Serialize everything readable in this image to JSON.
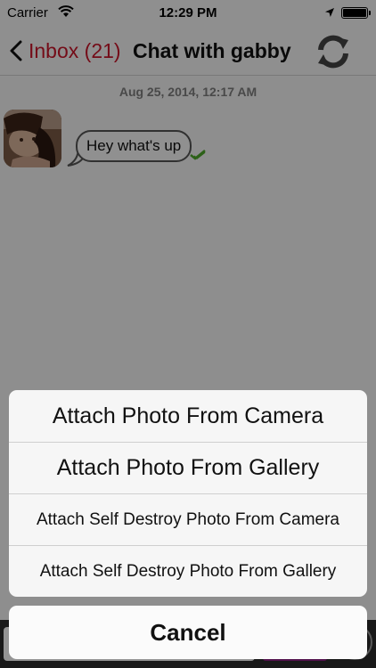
{
  "status_bar": {
    "carrier": "Carrier",
    "time": "12:29 PM",
    "icons": [
      "wifi-icon",
      "location-arrow-icon",
      "battery-icon"
    ]
  },
  "nav": {
    "back_label": "Inbox (21)",
    "title": "Chat with gabby",
    "back_color": "#c9162a",
    "icons": [
      "chevron-left-icon",
      "refresh-icon"
    ]
  },
  "chat": {
    "timestamp": "Aug 25, 2014, 12:17 AM",
    "messages": [
      {
        "text": "Hey what's up",
        "status_icon": "check-mark-icon",
        "status_color": "#4ea82a"
      }
    ]
  },
  "action_sheet": {
    "options": [
      "Attach Photo From Camera",
      "Attach Photo From Gallery",
      "Attach Self Destroy Photo From Camera",
      "Attach Self Destroy Photo From Gallery"
    ],
    "cancel": "Cancel"
  },
  "colors": {
    "accent": "#c9162a",
    "send_button": "#8e1f86",
    "overlay": "rgba(0,0,0,0.42)"
  }
}
